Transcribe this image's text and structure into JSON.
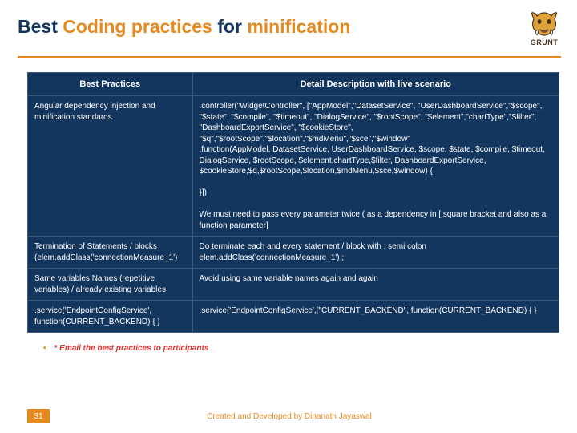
{
  "title": {
    "part1": "Best ",
    "part2": "Coding practices",
    "part3": " for ",
    "part4": "minification"
  },
  "logo": {
    "label": "GRUNT"
  },
  "headers": {
    "col1": "Best Practices",
    "col2": "Detail Description with live scenario"
  },
  "rows": [
    {
      "c1": "Angular dependency injection and minification standards",
      "c2": ".controller(\"WidgetController\", [\"AppModel\",\"DatasetService\", \"UserDashboardService\",\"$scope\", \"$state\", \"$compile\", \"$timeout\", \"DialogService\", \"$rootScope\", \"$element\",\"chartType\",\"$filter\", \"DashboardExportService\", \"$cookieStore\", \"$q\",\"$rootScope\",\"$location\",\"$mdMenu\",\"$sce\",\"$window\"\n,function(AppModel, DatasetService, UserDashboardService, $scope, $state, $compile, $timeout, DialogService, $rootScope, $element,chartType,$filter, DashboardExportService,\n$cookieStore,$q,$rootScope,$location,$mdMenu,$sce,$window) {\n\n}])\n\nWe must need to pass every parameter twice ( as a dependency in [ square bracket and also as a function parameter]"
    },
    {
      "c1": "Termination of Statements / blocks (elem.addClass('connectionMeasure_1')",
      "c2": "Do terminate each and every statement / block with ; semi colon\nelem.addClass('connectionMeasure_1') ;"
    },
    {
      "c1": "Same variables Names (repetitive variables) / already existing variables",
      "c2": "Avoid using same variable names again and again"
    },
    {
      "c1": ".service('EndpointConfigService', function(CURRENT_BACKEND) { }",
      "c2": ".service('EndpointConfigService',[\"CURRENT_BACKEND\", function(CURRENT_BACKEND) { }"
    }
  ],
  "note": "* Email the best practices to participants",
  "page": "31",
  "credit": "Created and Developed by Dinanath Jayaswal"
}
